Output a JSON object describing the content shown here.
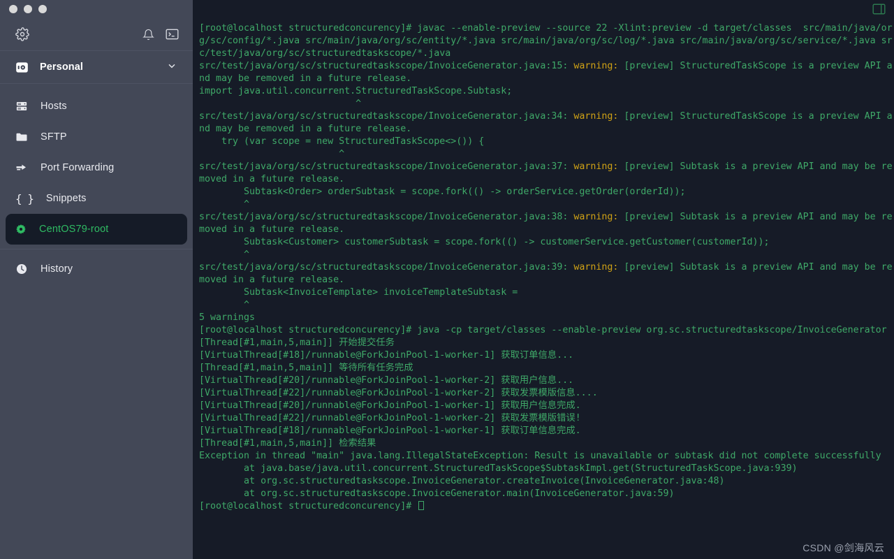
{
  "window": {
    "traffic_lights": [
      "close",
      "minimize",
      "maximize"
    ]
  },
  "sidebar": {
    "toolbar": {
      "settings_icon": "gear-icon",
      "notifications_icon": "bell-icon",
      "terminal_icon": "terminal-icon"
    },
    "group": {
      "label": "Personal",
      "icon": "vault-icon",
      "chevron": "chevron-down-icon"
    },
    "items": [
      {
        "label": "Hosts",
        "icon": "server-icon",
        "selected": false
      },
      {
        "label": "SFTP",
        "icon": "folder-icon",
        "selected": false
      },
      {
        "label": "Port Forwarding",
        "icon": "port-forwarding-icon",
        "selected": false
      },
      {
        "label": "Snippets",
        "icon": "braces-icon",
        "selected": false
      },
      {
        "label": "CentOS79-root",
        "icon": "gear-green-icon",
        "selected": true
      },
      {
        "label": "History",
        "icon": "clock-icon",
        "selected": false
      }
    ]
  },
  "terminal": {
    "split_icon": "split-pane-icon",
    "colors": {
      "background": "#161b27",
      "foreground": "#3fa968",
      "warning": "#d0a215",
      "sidebar_background": "#434857",
      "selected_item_background": "#151b27",
      "accent_green": "#2fbb63"
    },
    "prompt": "[root@localhost structuredconcurency]# ",
    "lines": [
      "[root@localhost structuredconcurency]# javac --enable-preview --source 22 -Xlint:preview -d target/classes  src/main/java/org/sc/config/*.java src/main/java/org/sc/entity/*.java src/main/java/org/sc/log/*.java src/main/java/org/sc/service/*.java src/test/java/org/sc/structuredtaskscope/*.java",
      "src/test/java/org/sc/structuredtaskscope/InvoiceGenerator.java:15: warning: [preview] StructuredTaskScope is a preview API and may be removed in a future release.",
      "import java.util.concurrent.StructuredTaskScope.Subtask;",
      "                            ^",
      "src/test/java/org/sc/structuredtaskscope/InvoiceGenerator.java:34: warning: [preview] StructuredTaskScope is a preview API and may be removed in a future release.",
      "    try (var scope = new StructuredTaskScope<>()) {",
      "                         ^",
      "src/test/java/org/sc/structuredtaskscope/InvoiceGenerator.java:37: warning: [preview] Subtask is a preview API and may be removed in a future release.",
      "        Subtask<Order> orderSubtask = scope.fork(() -> orderService.getOrder(orderId));",
      "        ^",
      "src/test/java/org/sc/structuredtaskscope/InvoiceGenerator.java:38: warning: [preview] Subtask is a preview API and may be removed in a future release.",
      "        Subtask<Customer> customerSubtask = scope.fork(() -> customerService.getCustomer(customerId));",
      "        ^",
      "src/test/java/org/sc/structuredtaskscope/InvoiceGenerator.java:39: warning: [preview] Subtask is a preview API and may be removed in a future release.",
      "        Subtask<InvoiceTemplate> invoiceTemplateSubtask =",
      "        ^",
      "5 warnings",
      "[root@localhost structuredconcurency]# java -cp target/classes --enable-preview org.sc.structuredtaskscope/InvoiceGenerator",
      "[Thread[#1,main,5,main]] 开始提交任务",
      "[VirtualThread[#18]/runnable@ForkJoinPool-1-worker-1] 获取订单信息...",
      "[Thread[#1,main,5,main]] 等待所有任务完成",
      "[VirtualThread[#20]/runnable@ForkJoinPool-1-worker-2] 获取用户信息...",
      "[VirtualThread[#22]/runnable@ForkJoinPool-1-worker-2] 获取发票模版信息....",
      "[VirtualThread[#20]/runnable@ForkJoinPool-1-worker-1] 获取用户信息完成.",
      "[VirtualThread[#22]/runnable@ForkJoinPool-1-worker-2] 获取发票模版错误!",
      "[VirtualThread[#18]/runnable@ForkJoinPool-1-worker-1] 获取订单信息完成.",
      "[Thread[#1,main,5,main]] 检索结果",
      "Exception in thread \"main\" java.lang.IllegalStateException: Result is unavailable or subtask did not complete successfully",
      "        at java.base/java.util.concurrent.StructuredTaskScope$SubtaskImpl.get(StructuredTaskScope.java:939)",
      "        at org.sc.structuredtaskscope.InvoiceGenerator.createInvoice(InvoiceGenerator.java:48)",
      "        at org.sc.structuredtaskscope.InvoiceGenerator.main(InvoiceGenerator.java:59)",
      "[root@localhost structuredconcurency]# "
    ]
  },
  "watermark": {
    "text": "CSDN @剑海风云"
  }
}
